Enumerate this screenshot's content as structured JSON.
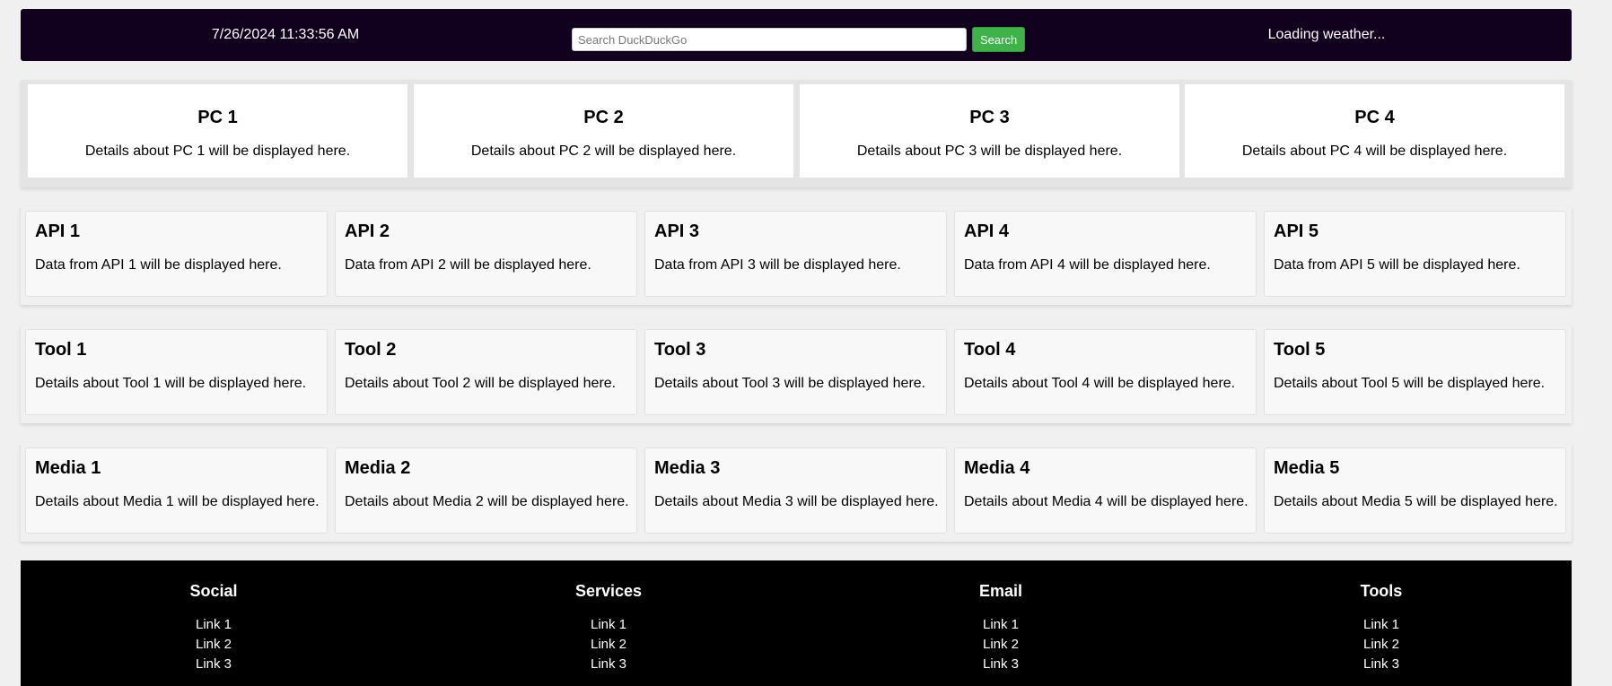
{
  "header": {
    "datetime": "7/26/2024 11:33:56 AM",
    "search_placeholder": "Search DuckDuckGo",
    "search_button": "Search",
    "weather": "Loading weather..."
  },
  "pcs": [
    {
      "title": "PC 1",
      "text": "Details about PC 1 will be displayed here."
    },
    {
      "title": "PC 2",
      "text": "Details about PC 2 will be displayed here."
    },
    {
      "title": "PC 3",
      "text": "Details about PC 3 will be displayed here."
    },
    {
      "title": "PC 4",
      "text": "Details about PC 4 will be displayed here."
    }
  ],
  "apis": [
    {
      "title": "API 1",
      "text": "Data from API 1 will be displayed here."
    },
    {
      "title": "API 2",
      "text": "Data from API 2 will be displayed here."
    },
    {
      "title": "API 3",
      "text": "Data from API 3 will be displayed here."
    },
    {
      "title": "API 4",
      "text": "Data from API 4 will be displayed here."
    },
    {
      "title": "API 5",
      "text": "Data from API 5 will be displayed here."
    }
  ],
  "tools": [
    {
      "title": "Tool 1",
      "text": "Details about Tool 1 will be displayed here."
    },
    {
      "title": "Tool 2",
      "text": "Details about Tool 2 will be displayed here."
    },
    {
      "title": "Tool 3",
      "text": "Details about Tool 3 will be displayed here."
    },
    {
      "title": "Tool 4",
      "text": "Details about Tool 4 will be displayed here."
    },
    {
      "title": "Tool 5",
      "text": "Details about Tool 5 will be displayed here."
    }
  ],
  "media": [
    {
      "title": "Media 1",
      "text": "Details about Media 1 will be displayed here."
    },
    {
      "title": "Media 2",
      "text": "Details about Media 2 will be displayed here."
    },
    {
      "title": "Media 3",
      "text": "Details about Media 3 will be displayed here."
    },
    {
      "title": "Media 4",
      "text": "Details about Media 4 will be displayed here."
    },
    {
      "title": "Media 5",
      "text": "Details about Media 5 will be displayed here."
    }
  ],
  "footer": {
    "columns": [
      {
        "title": "Social",
        "links": [
          "Link 1",
          "Link 2",
          "Link 3"
        ]
      },
      {
        "title": "Services",
        "links": [
          "Link 1",
          "Link 2",
          "Link 3"
        ]
      },
      {
        "title": "Email",
        "links": [
          "Link 1",
          "Link 2",
          "Link 3"
        ]
      },
      {
        "title": "Tools",
        "links": [
          "Link 1",
          "Link 2",
          "Link 3"
        ]
      }
    ]
  }
}
